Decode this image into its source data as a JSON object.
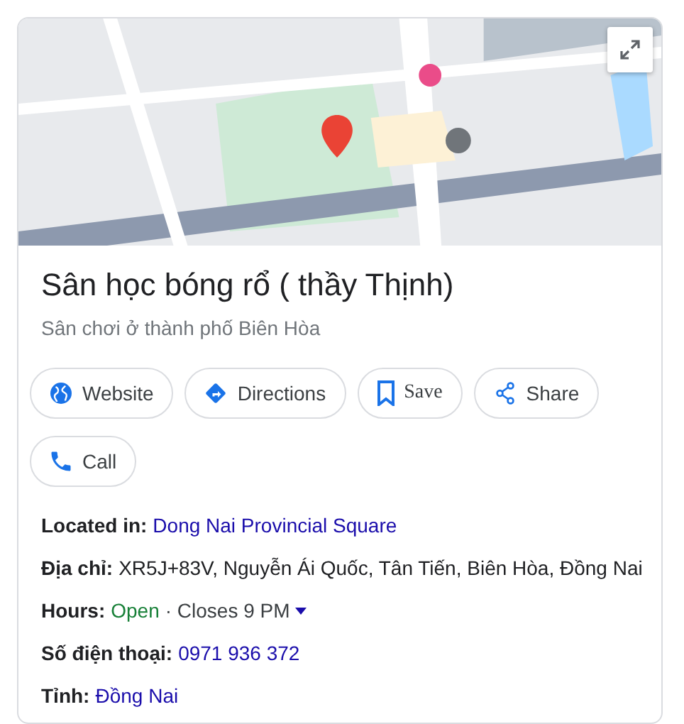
{
  "place": {
    "title": "Sân học bóng rổ ( thầy Thịnh)",
    "category": "Sân chơi ở thành phố Biên Hòa"
  },
  "actions": [
    {
      "kind": "website",
      "label": "Website"
    },
    {
      "kind": "directions",
      "label": "Directions"
    },
    {
      "kind": "save",
      "label": "Save"
    },
    {
      "kind": "share",
      "label": "Share"
    },
    {
      "kind": "call",
      "label": "Call"
    }
  ],
  "facts": [
    {
      "kind": "link",
      "label": "Located in:",
      "value": "Dong Nai Provincial Square"
    },
    {
      "kind": "text",
      "label": "Địa chỉ:",
      "value": "XR5J+83V, Nguyễn Ái Quốc, Tân Tiến, Biên Hòa, Đồng Nai"
    },
    {
      "kind": "hours",
      "label": "Hours:",
      "status": "Open",
      "value": "· Closes 9 PM"
    },
    {
      "kind": "link",
      "label": "Số điện thoại:",
      "value": "0971 936 372"
    },
    {
      "kind": "link",
      "label": "Tỉnh:",
      "value": "Đồng Nai"
    }
  ]
}
